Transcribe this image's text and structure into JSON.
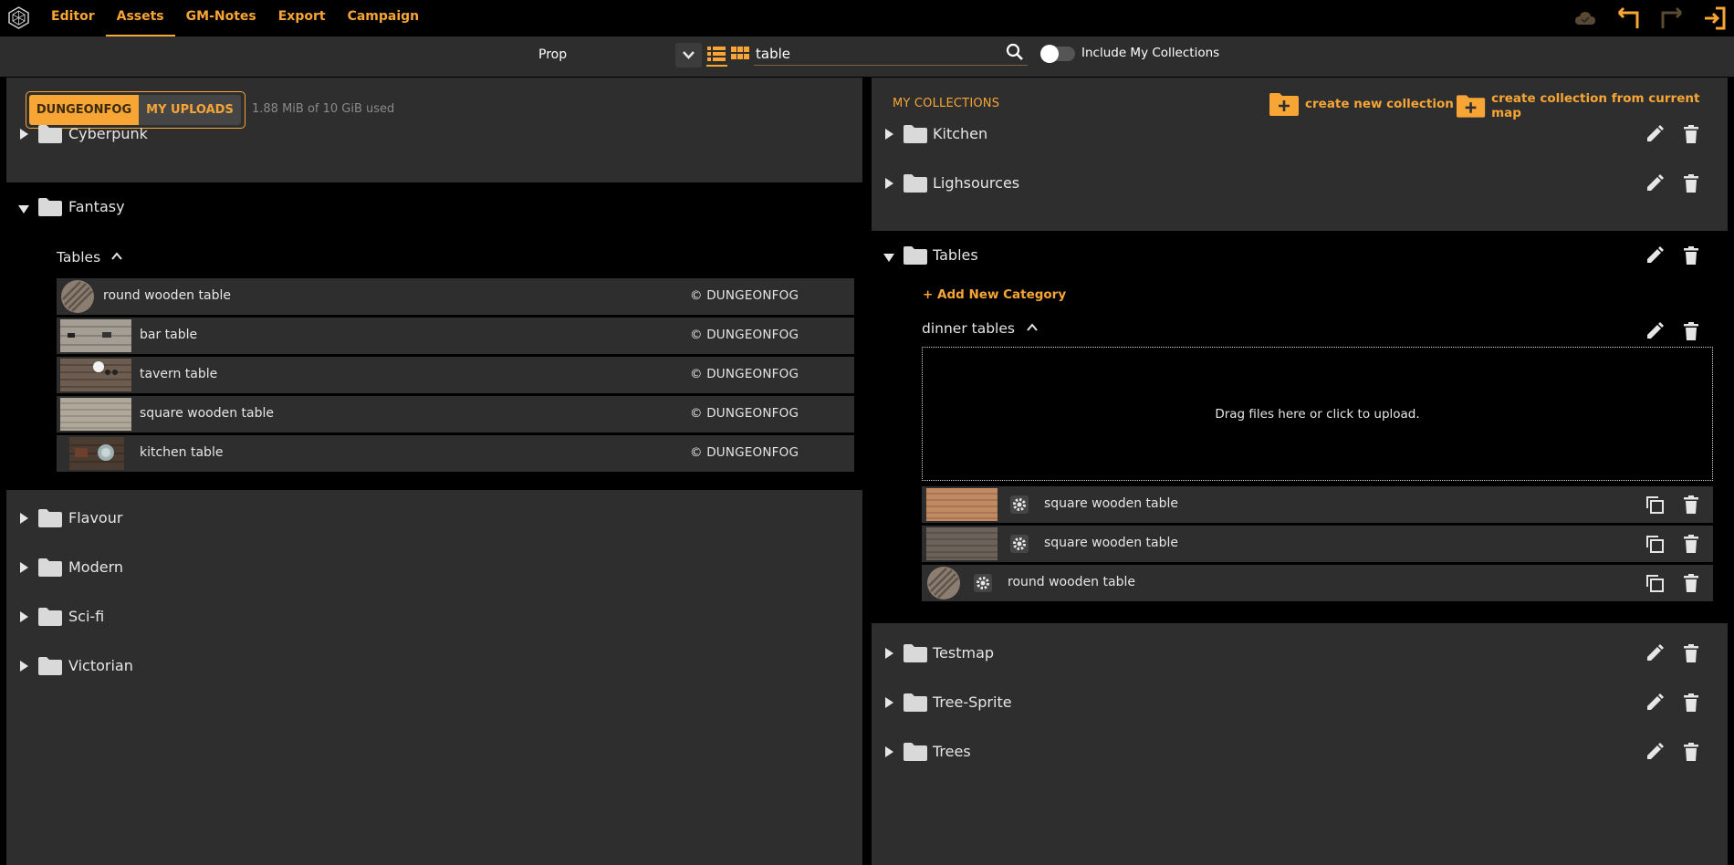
{
  "nav": {
    "items": [
      "Editor",
      "Assets",
      "GM-Notes",
      "Export",
      "Campaign"
    ],
    "active": "Assets"
  },
  "toolbar": {
    "type_label": "Prop",
    "search_value": "table",
    "search_placeholder": "",
    "include_collections_label": "Include My Collections"
  },
  "library": {
    "sources": [
      "DUNGEONFOG",
      "MY UPLOADS"
    ],
    "active_source": "DUNGEONFOG",
    "usage": "1.88 MiB of 10 GiB used",
    "folders": [
      "Cyberpunk",
      "Fantasy",
      "Flavour",
      "Modern",
      "Sci-fi",
      "Victorian"
    ],
    "expanded_folder": "Fantasy",
    "category": "Tables",
    "assets": [
      {
        "name": "round wooden table",
        "copyright": "© DUNGEONFOG"
      },
      {
        "name": "bar table",
        "copyright": "© DUNGEONFOG"
      },
      {
        "name": "tavern table",
        "copyright": "© DUNGEONFOG"
      },
      {
        "name": "square wooden table",
        "copyright": "© DUNGEONFOG"
      },
      {
        "name": "kitchen table",
        "copyright": "© DUNGEONFOG"
      }
    ]
  },
  "collections": {
    "title": "MY COLLECTIONS",
    "create_new": "create new collection",
    "create_from_map": "create collection from current map",
    "items": [
      "Kitchen",
      "Lighsources",
      "Tables",
      "Testmap",
      "Tree-Sprite",
      "Trees"
    ],
    "expanded": "Tables",
    "add_category": "Add New Category",
    "category": "dinner tables",
    "dropzone": "Drag files here or click to upload.",
    "assets": [
      "square wooden table",
      "square wooden table",
      "round wooden table"
    ]
  },
  "colors": {
    "accent": "#f7a535",
    "panel": "#2e2e2e",
    "background": "#000000"
  }
}
